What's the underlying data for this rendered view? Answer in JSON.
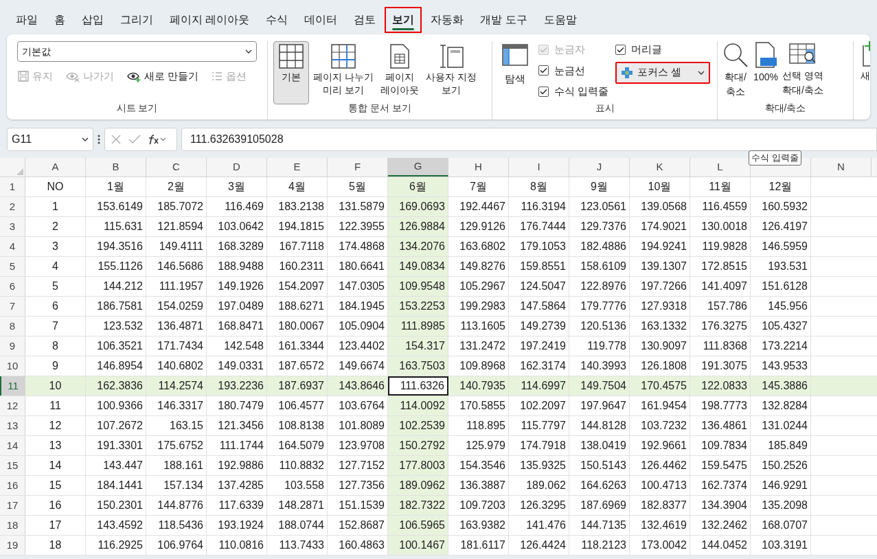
{
  "tabs": [
    {
      "label": "파일",
      "selected": false,
      "highlighted": false
    },
    {
      "label": "홈",
      "selected": false,
      "highlighted": false
    },
    {
      "label": "삽입",
      "selected": false,
      "highlighted": false
    },
    {
      "label": "그리기",
      "selected": false,
      "highlighted": false
    },
    {
      "label": "페이지 레이아웃",
      "selected": false,
      "highlighted": false
    },
    {
      "label": "수식",
      "selected": false,
      "highlighted": false
    },
    {
      "label": "데이터",
      "selected": false,
      "highlighted": false
    },
    {
      "label": "검토",
      "selected": false,
      "highlighted": false
    },
    {
      "label": "보기",
      "selected": true,
      "highlighted": true
    },
    {
      "label": "자동화",
      "selected": false,
      "highlighted": false
    },
    {
      "label": "개발 도구",
      "selected": false,
      "highlighted": false
    },
    {
      "label": "도움말",
      "selected": false,
      "highlighted": false
    }
  ],
  "ribbon": {
    "sheet_view": {
      "title": "시트 보기",
      "dropdown": "기본값",
      "buttons": [
        {
          "kind": "save",
          "label": "유지",
          "disabled": true
        },
        {
          "kind": "exit",
          "label": "나가기",
          "disabled": true
        },
        {
          "kind": "new",
          "label": "새로 만들기",
          "disabled": false
        },
        {
          "kind": "options",
          "label": "옵션",
          "disabled": true
        }
      ]
    },
    "workbook_views": {
      "title": "통합 문서 보기",
      "buttons": [
        {
          "kind": "normal",
          "label": "기본",
          "selected": true
        },
        {
          "kind": "pagebreak",
          "label": "페이지 나누기\n미리 보기",
          "selected": false
        },
        {
          "kind": "layout",
          "label": "페이지\n레이아웃",
          "selected": false
        },
        {
          "kind": "custom",
          "label": "사용자 지정\n보기",
          "selected": false
        }
      ]
    },
    "show": {
      "title": "표시",
      "navigation": "탐색",
      "checkboxes": [
        {
          "label": "눈금자",
          "checked": true,
          "disabled": true
        },
        {
          "label": "눈금선",
          "checked": true,
          "disabled": false
        },
        {
          "label": "수식 입력줄",
          "checked": true,
          "disabled": false
        },
        {
          "label": "머리글",
          "checked": true,
          "disabled": false
        }
      ],
      "focus_cell": {
        "label": "포커스 셀",
        "highlighted": true
      }
    },
    "zoom": {
      "title": "확대/축소",
      "buttons": [
        {
          "kind": "zoom",
          "label": "확대/\n축소"
        },
        {
          "kind": "hundred",
          "label": "100%"
        },
        {
          "kind": "selection",
          "label": "선택 영역\n확대/축소"
        }
      ]
    },
    "cut_group": {
      "label": "새"
    }
  },
  "formula_bar": {
    "name_box": "G11",
    "value": "111.632639105028"
  },
  "tooltip": "수식 입력줄",
  "grid": {
    "columns": [
      {
        "label": "A",
        "selected": false
      },
      {
        "label": "B",
        "selected": false
      },
      {
        "label": "C",
        "selected": false
      },
      {
        "label": "D",
        "selected": false
      },
      {
        "label": "E",
        "selected": false
      },
      {
        "label": "F",
        "selected": false
      },
      {
        "label": "G",
        "selected": true
      },
      {
        "label": "H",
        "selected": false
      },
      {
        "label": "I",
        "selected": false
      },
      {
        "label": "J",
        "selected": false
      },
      {
        "label": "K",
        "selected": false
      },
      {
        "label": "L",
        "selected": false
      },
      {
        "selected": false
      },
      {
        "label": "N",
        "selected": false
      }
    ],
    "rows": [
      {
        "number": "1",
        "selected": false,
        "cells": [
          "NO",
          "1월",
          "2월",
          "3월",
          "4월",
          "5월",
          "6월",
          "7월",
          "8월",
          "9월",
          "10월",
          "11월",
          "12월"
        ]
      },
      {
        "number": "2",
        "selected": false,
        "cells": [
          "1",
          "153.6149",
          "185.7072",
          "116.469",
          "183.2138",
          "131.5879",
          "169.0693",
          "192.4467",
          "116.3194",
          "123.0561",
          "139.0568",
          "116.4559",
          "160.5932"
        ]
      },
      {
        "number": "3",
        "selected": false,
        "cells": [
          "2",
          "115.631",
          "121.8594",
          "103.0642",
          "194.1815",
          "122.3955",
          "126.9884",
          "129.9126",
          "176.7444",
          "129.7376",
          "174.9021",
          "130.0018",
          "126.4197"
        ]
      },
      {
        "number": "4",
        "selected": false,
        "cells": [
          "3",
          "194.3516",
          "149.4111",
          "168.3289",
          "167.7118",
          "174.4868",
          "134.2076",
          "163.6802",
          "179.1053",
          "182.4886",
          "194.9241",
          "119.9828",
          "146.5959"
        ]
      },
      {
        "number": "5",
        "selected": false,
        "cells": [
          "4",
          "155.1126",
          "146.5686",
          "188.9488",
          "160.2311",
          "180.6641",
          "149.0834",
          "149.8276",
          "159.8551",
          "158.6109",
          "139.1307",
          "172.8515",
          "193.531"
        ]
      },
      {
        "number": "6",
        "selected": false,
        "cells": [
          "5",
          "144.212",
          "111.1957",
          "149.1926",
          "154.2097",
          "147.0305",
          "109.9548",
          "105.2967",
          "124.5047",
          "122.8976",
          "197.7266",
          "141.4097",
          "151.6128"
        ]
      },
      {
        "number": "7",
        "selected": false,
        "cells": [
          "6",
          "186.7581",
          "154.0259",
          "197.0489",
          "188.6271",
          "184.1945",
          "153.2253",
          "199.2983",
          "147.5864",
          "179.7776",
          "127.9318",
          "157.786",
          "145.956"
        ]
      },
      {
        "number": "8",
        "selected": false,
        "cells": [
          "7",
          "123.532",
          "136.4871",
          "168.8471",
          "180.0067",
          "105.0904",
          "111.8985",
          "113.1605",
          "149.2739",
          "120.5136",
          "163.1332",
          "176.3275",
          "105.4327"
        ]
      },
      {
        "number": "9",
        "selected": false,
        "cells": [
          "8",
          "106.3521",
          "171.7434",
          "142.548",
          "161.3344",
          "123.4402",
          "154.317",
          "131.2472",
          "197.2419",
          "119.778",
          "130.9097",
          "111.8368",
          "173.2214"
        ]
      },
      {
        "number": "10",
        "selected": false,
        "cells": [
          "9",
          "146.8954",
          "140.6802",
          "149.0331",
          "187.6572",
          "149.6674",
          "163.7503",
          "109.8968",
          "162.3174",
          "140.3993",
          "126.1808",
          "191.3075",
          "143.9533"
        ]
      },
      {
        "number": "11",
        "selected": true,
        "cells": [
          "10",
          "162.3836",
          "114.2574",
          "193.2236",
          "187.6937",
          "143.8646",
          "111.6326",
          "140.7935",
          "114.6997",
          "149.7504",
          "170.4575",
          "122.0833",
          "145.3886"
        ]
      },
      {
        "number": "12",
        "selected": false,
        "cells": [
          "11",
          "100.9366",
          "146.3317",
          "180.7479",
          "106.4577",
          "103.6764",
          "114.0092",
          "170.5855",
          "102.2097",
          "197.9647",
          "161.9454",
          "198.7773",
          "132.8284"
        ]
      },
      {
        "number": "13",
        "selected": false,
        "cells": [
          "12",
          "107.2672",
          "163.15",
          "121.3456",
          "108.8138",
          "101.8089",
          "102.2539",
          "118.895",
          "115.7797",
          "144.8128",
          "103.7232",
          "136.4861",
          "131.0244"
        ]
      },
      {
        "number": "14",
        "selected": false,
        "cells": [
          "13",
          "191.3301",
          "175.6752",
          "111.1744",
          "164.5079",
          "123.9708",
          "150.2792",
          "125.979",
          "174.7918",
          "138.0419",
          "192.9661",
          "109.7834",
          "185.849"
        ]
      },
      {
        "number": "15",
        "selected": false,
        "cells": [
          "14",
          "143.447",
          "188.161",
          "192.9886",
          "110.8832",
          "127.7152",
          "177.8003",
          "154.3546",
          "135.9325",
          "150.5143",
          "126.4462",
          "159.5475",
          "150.2526"
        ]
      },
      {
        "number": "16",
        "selected": false,
        "cells": [
          "15",
          "184.1441",
          "157.134",
          "137.4285",
          "103.558",
          "127.7356",
          "189.0962",
          "136.3887",
          "189.062",
          "164.6263",
          "100.4713",
          "162.7374",
          "146.9291"
        ]
      },
      {
        "number": "17",
        "selected": false,
        "cells": [
          "16",
          "150.2301",
          "144.8776",
          "117.6339",
          "148.2871",
          "151.1539",
          "182.7322",
          "109.7203",
          "126.3295",
          "187.6969",
          "182.8377",
          "134.3904",
          "135.2098"
        ]
      },
      {
        "number": "18",
        "selected": false,
        "cells": [
          "17",
          "143.4592",
          "118.5436",
          "193.1924",
          "188.0744",
          "152.8687",
          "106.5965",
          "163.9382",
          "141.476",
          "144.7135",
          "132.4619",
          "132.2462",
          "168.0707"
        ]
      },
      {
        "number": "19",
        "selected": false,
        "cells": [
          "18",
          "116.2925",
          "106.9764",
          "110.0816",
          "113.7433",
          "160.4863",
          "100.1467",
          "181.6117",
          "126.4424",
          "118.2123",
          "173.0042",
          "144.0452",
          "103.3191"
        ]
      }
    ]
  }
}
